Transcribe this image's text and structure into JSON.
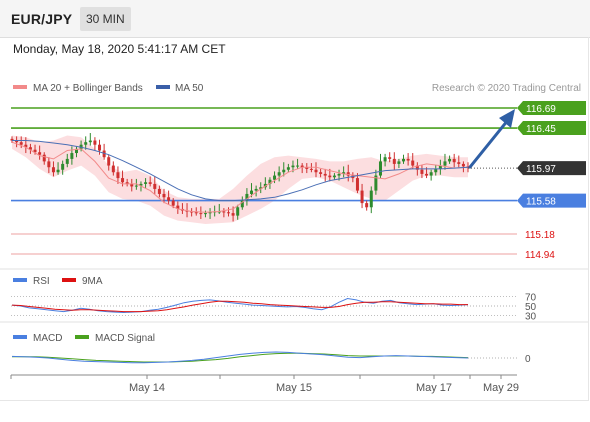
{
  "header": {
    "pair": "EUR/JPY",
    "timeframe": "30 MIN"
  },
  "datetime": "Monday, May 18, 2020 5:41:17 AM CET",
  "colors": {
    "green": "#4aa11e",
    "blue": "#4a7fe0",
    "red": "#e06464",
    "candle_up": "#2e8b2e",
    "candle_down": "#d03030",
    "ma50": "#4a6fb5",
    "ma20": "#f28a8a",
    "bands": "#fbd3d6",
    "arrow": "#2f5fa5",
    "price_tag": "#333333"
  },
  "main_legend": {
    "ma20_label": "MA 20 + Bollinger Bands",
    "ma50_label": "MA 50",
    "source": "Research © 2020 Trading Central"
  },
  "rsi_legend": {
    "rsi_label": "RSI",
    "ma_label": "9MA"
  },
  "macd_legend": {
    "macd_label": "MACD",
    "signal_label": "MACD Signal"
  },
  "chart_data": [
    {
      "type": "candlestick",
      "title": "",
      "ylim": [
        114.85,
        116.75
      ],
      "x_labels": [
        "May 14",
        "May 15",
        "May 17",
        "May 29"
      ],
      "last_price": "115.97",
      "levels": [
        {
          "value": 116.69,
          "label": "116.69",
          "kind": "resistance"
        },
        {
          "value": 116.45,
          "label": "116.45",
          "kind": "resistance"
        },
        {
          "value": 115.58,
          "label": "115.58",
          "kind": "pivot"
        },
        {
          "value": 115.18,
          "label": "115.18",
          "kind": "support"
        },
        {
          "value": 114.94,
          "label": "114.94",
          "kind": "support"
        }
      ],
      "close_series": [
        116.3,
        116.28,
        116.25,
        116.22,
        116.19,
        116.16,
        116.13,
        116.05,
        115.98,
        115.92,
        115.95,
        116.02,
        116.08,
        116.15,
        116.2,
        116.25,
        116.28,
        116.3,
        116.25,
        116.18,
        116.1,
        116.0,
        115.92,
        115.85,
        115.8,
        115.78,
        115.75,
        115.76,
        115.78,
        115.8,
        115.78,
        115.72,
        115.66,
        115.62,
        115.58,
        115.52,
        115.48,
        115.46,
        115.45,
        115.44,
        115.43,
        115.42,
        115.43,
        115.44,
        115.45,
        115.45,
        115.44,
        115.43,
        115.4,
        115.5,
        115.58,
        115.66,
        115.7,
        115.72,
        115.74,
        115.78,
        115.83,
        115.88,
        115.92,
        115.95,
        115.98,
        116.0,
        116.0,
        115.98,
        115.96,
        115.95,
        115.92,
        115.9,
        115.88,
        115.86,
        115.88,
        115.9,
        115.92,
        115.88,
        115.85,
        115.7,
        115.55,
        115.5,
        115.7,
        115.88,
        116.05,
        116.1,
        116.08,
        116.02,
        116.05,
        116.08,
        116.06,
        116.0,
        115.95,
        115.9,
        115.88,
        115.92,
        115.96,
        116.0,
        116.05,
        116.08,
        116.04,
        116.02,
        115.99,
        115.97
      ],
      "ma50_series": [
        116.3,
        116.3,
        116.29,
        116.27,
        116.25,
        116.22,
        116.18,
        116.13,
        116.06,
        115.98,
        115.9,
        115.81,
        115.72,
        115.65,
        115.6,
        115.58,
        115.58,
        115.59,
        115.6,
        115.62,
        115.66,
        115.71,
        115.77,
        115.82,
        115.85,
        115.88,
        115.91,
        115.94,
        115.95,
        115.96,
        115.96,
        115.96,
        115.97,
        115.98
      ],
      "ma20_series": [
        116.28,
        116.22,
        116.12,
        116.08,
        116.18,
        116.2,
        116.05,
        115.85,
        115.78,
        115.78,
        115.7,
        115.56,
        115.48,
        115.45,
        115.44,
        115.45,
        115.48,
        115.6,
        115.72,
        115.82,
        115.92,
        115.98,
        115.98,
        115.94,
        115.9,
        115.88,
        115.86,
        115.84,
        115.9,
        115.98,
        116.02,
        116.0,
        115.97,
        115.98
      ],
      "bands_upper": [
        116.36,
        116.34,
        116.28,
        116.3,
        116.36,
        116.34,
        116.2,
        116.0,
        115.92,
        115.95,
        115.88,
        115.7,
        115.62,
        115.6,
        115.6,
        115.6,
        115.72,
        115.88,
        116.02,
        116.1,
        116.12,
        116.1,
        116.08,
        116.05,
        116.05,
        116.08,
        116.1,
        116.05,
        116.08,
        116.12,
        116.14,
        116.12,
        116.1,
        116.1
      ],
      "bands_lower": [
        116.2,
        116.1,
        115.96,
        115.86,
        115.94,
        116.0,
        115.88,
        115.68,
        115.6,
        115.58,
        115.52,
        115.4,
        115.34,
        115.32,
        115.3,
        115.31,
        115.32,
        115.4,
        115.48,
        115.58,
        115.72,
        115.84,
        115.86,
        115.82,
        115.74,
        115.66,
        115.6,
        115.58,
        115.7,
        115.82,
        115.88,
        115.88,
        115.86,
        115.86
      ],
      "forecast_target": "116.69"
    },
    {
      "type": "line",
      "title": "",
      "ylim": [
        20,
        80
      ],
      "y_ticks": [
        "70",
        "50",
        "30"
      ],
      "series": [
        {
          "name": "RSI",
          "values": [
            52,
            50,
            46,
            44,
            42,
            40,
            38,
            41,
            45,
            43,
            40,
            38,
            37,
            36,
            37,
            38,
            41,
            43,
            47,
            52,
            57,
            60,
            62,
            63,
            61,
            58,
            56,
            54,
            52,
            51,
            50,
            49,
            48,
            49,
            47,
            44,
            42,
            48,
            58,
            66,
            63,
            58,
            56,
            60,
            62,
            57,
            55,
            53,
            54,
            55,
            52,
            51,
            52,
            53
          ]
        },
        {
          "name": "9MA",
          "values": [
            52,
            51,
            49,
            47,
            45,
            43,
            42,
            41,
            42,
            42,
            41,
            40,
            39,
            38,
            38,
            38,
            39,
            40,
            42,
            45,
            48,
            52,
            55,
            58,
            60,
            60,
            59,
            58,
            56,
            55,
            53,
            52,
            51,
            50,
            49,
            48,
            47,
            47,
            49,
            53,
            56,
            58,
            58,
            59,
            59,
            58,
            57,
            56,
            55,
            55,
            54,
            54,
            53,
            53
          ]
        }
      ]
    },
    {
      "type": "line",
      "title": "",
      "ylim": [
        -0.3,
        0.3
      ],
      "y_ticks": [
        "0"
      ],
      "series": [
        {
          "name": "MACD",
          "values": [
            0.04,
            0.03,
            0.02,
            0.0,
            -0.03,
            -0.06,
            -0.08,
            -0.09,
            -0.1,
            -0.11,
            -0.12,
            -0.12,
            -0.11,
            -0.1,
            -0.08,
            -0.06,
            -0.03,
            0.01,
            0.05,
            0.09,
            0.12,
            0.14,
            0.15,
            0.14,
            0.12,
            0.1,
            0.08,
            0.05,
            0.02,
            0.01,
            0.03,
            0.05,
            0.06,
            0.05,
            0.04,
            0.03,
            0.02,
            0.01,
            0.0
          ]
        },
        {
          "name": "MACD Signal",
          "values": [
            0.03,
            0.03,
            0.03,
            0.02,
            0.0,
            -0.02,
            -0.04,
            -0.06,
            -0.07,
            -0.08,
            -0.09,
            -0.1,
            -0.1,
            -0.1,
            -0.09,
            -0.08,
            -0.06,
            -0.04,
            -0.01,
            0.03,
            0.06,
            0.09,
            0.11,
            0.12,
            0.12,
            0.11,
            0.1,
            0.08,
            0.06,
            0.05,
            0.05,
            0.05,
            0.05,
            0.05,
            0.04,
            0.04,
            0.03,
            0.02,
            0.01
          ]
        }
      ]
    }
  ]
}
